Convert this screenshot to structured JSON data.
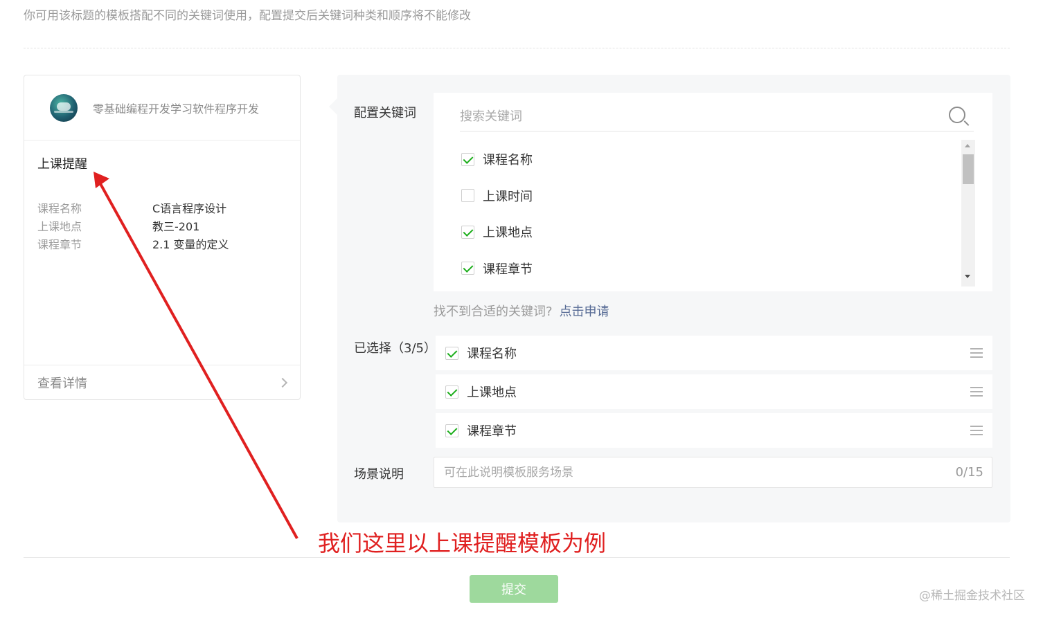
{
  "hint_text": "你可用该标题的模板搭配不同的关键词使用，配置提交后关键词种类和顺序将不能修改",
  "preview": {
    "account_name": "零基础编程开发学习软件程序开发",
    "template_title": "上课提醒",
    "fields": [
      {
        "key": "课程名称",
        "value": "C语言程序设计"
      },
      {
        "key": "上课地点",
        "value": "教三-201"
      },
      {
        "key": "课程章节",
        "value": "2.1 变量的定义"
      }
    ],
    "detail_label": "查看详情"
  },
  "config": {
    "keywords_label": "配置关键词",
    "search_placeholder": "搜索关键词",
    "keywords": [
      {
        "label": "课程名称",
        "checked": true
      },
      {
        "label": "上课时间",
        "checked": false
      },
      {
        "label": "上课地点",
        "checked": true
      },
      {
        "label": "课程章节",
        "checked": true
      }
    ],
    "notfound_text": "找不到合适的关键词?",
    "apply_link": "点击申请",
    "selected_label": "已选择（3/5）",
    "selected": [
      "课程名称",
      "上课地点",
      "课程章节"
    ],
    "scene_label": "场景说明",
    "scene_placeholder": "可在此说明模板服务场景",
    "scene_counter": "0/15"
  },
  "annotation": "我们这里以上课提醒模板为例",
  "submit_label": "提交",
  "watermark": "@稀土掘金技术社区",
  "colors": {
    "accent_green": "#1aad19",
    "submit_disabled": "#9ed99d",
    "annotation_red": "#e02020",
    "link_blue": "#576b95"
  }
}
